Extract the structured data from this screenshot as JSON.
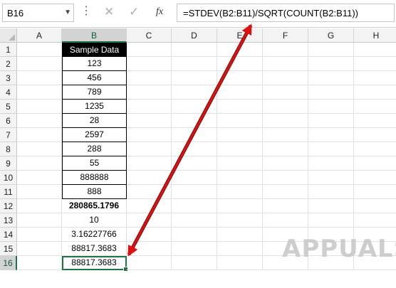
{
  "name_box": {
    "value": "B16"
  },
  "formula_bar": {
    "formula": "=STDEV(B2:B11)/SQRT(COUNT(B2:B11))"
  },
  "columns": [
    "A",
    "B",
    "C",
    "D",
    "E",
    "F",
    "G",
    "H"
  ],
  "selected_column": "B",
  "selected_row": "16",
  "rows": [
    {
      "num": "1",
      "b": "Sample Data"
    },
    {
      "num": "2",
      "b": "123"
    },
    {
      "num": "3",
      "b": "456"
    },
    {
      "num": "4",
      "b": "789"
    },
    {
      "num": "5",
      "b": "1235"
    },
    {
      "num": "6",
      "b": "28"
    },
    {
      "num": "7",
      "b": "2597"
    },
    {
      "num": "8",
      "b": "288"
    },
    {
      "num": "9",
      "b": "55"
    },
    {
      "num": "10",
      "b": "888888"
    },
    {
      "num": "11",
      "b": "888"
    },
    {
      "num": "12",
      "b": "280865.1796"
    },
    {
      "num": "13",
      "b": "10"
    },
    {
      "num": "14",
      "b": "3.16227766"
    },
    {
      "num": "15",
      "b": "88817.3683"
    },
    {
      "num": "16",
      "b": "88817.3683"
    }
  ],
  "watermark": {
    "text": "APPUALS"
  },
  "colors": {
    "accent": "#217346",
    "arrow": "#e01010",
    "header_fill": "#000000"
  },
  "icons": {
    "cancel": "close-icon",
    "enter": "check-icon",
    "function": "fx-icon"
  }
}
